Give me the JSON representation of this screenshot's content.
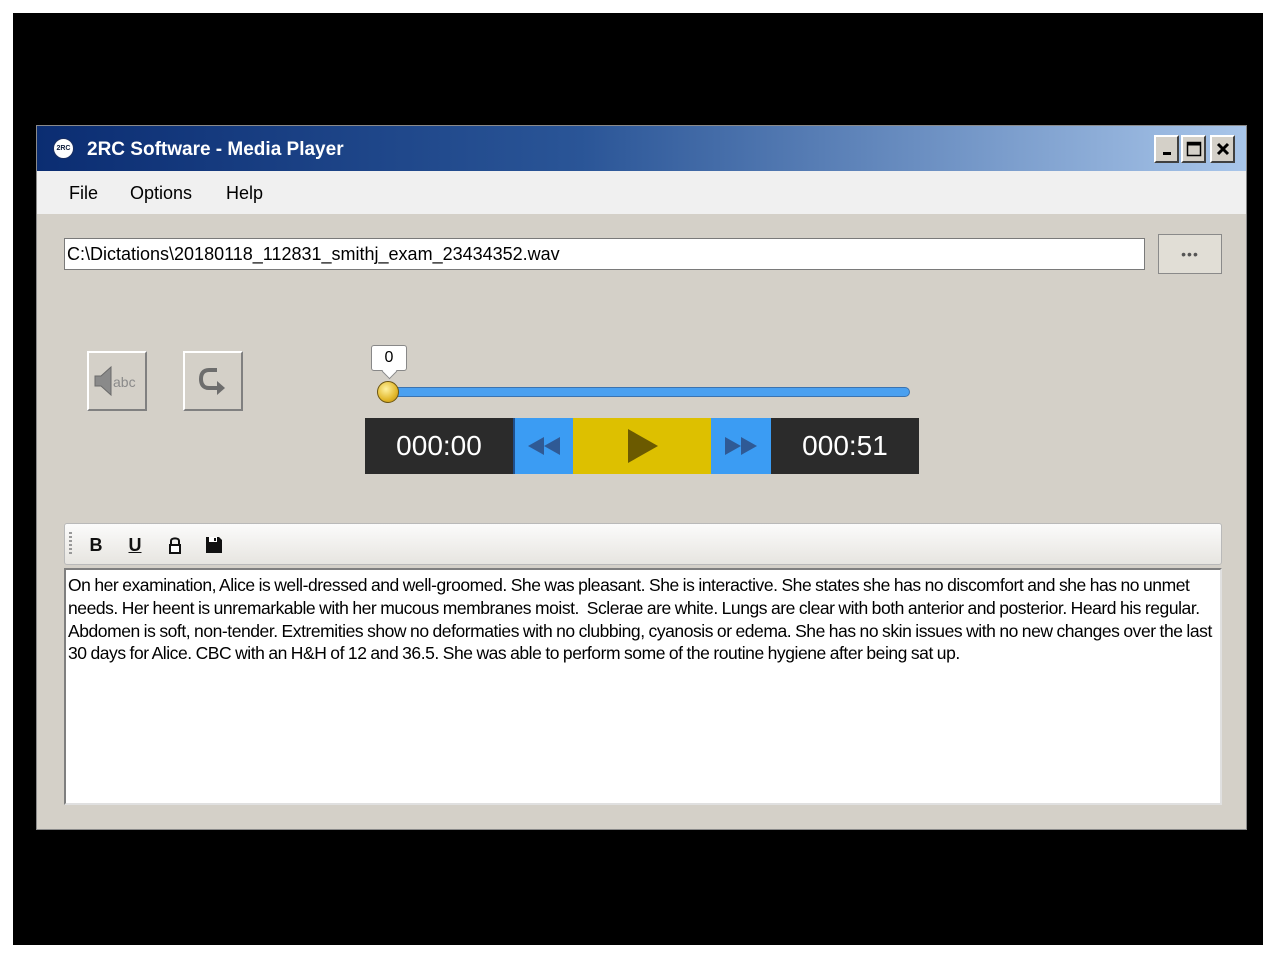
{
  "window": {
    "title": "2RC Software - Media Player",
    "logo_text": "2RC",
    "icons": {
      "logo": "app-logo-icon",
      "minimize": "minimize-icon",
      "maximize": "maximize-icon",
      "close": "close-icon"
    }
  },
  "menu": {
    "items": [
      {
        "label": "File"
      },
      {
        "label": "Options"
      },
      {
        "label": "Help"
      }
    ]
  },
  "file": {
    "path": "C:\\Dictations\\20180118_112831_smithj_exam_23434352.wav",
    "browse_label": "•••"
  },
  "tools": {
    "speak_icon": "speaker-abc-icon",
    "redo_icon": "redo-arrow-icon"
  },
  "player": {
    "position_value": "0",
    "progress_fraction": 0,
    "current_time": "000:00",
    "total_time": "000:51",
    "icons": {
      "rewind": "rewind-icon",
      "play": "play-icon",
      "forward": "fast-forward-icon"
    },
    "colors": {
      "time_bg": "#2b2b2b",
      "skip_bg": "#3b9cf3",
      "play_bg": "#ddc000"
    }
  },
  "editor": {
    "toolbar": {
      "bold_label": "B",
      "underline_label": "U",
      "icons": {
        "lock": "lock-icon",
        "save": "save-icon"
      }
    },
    "text": "On her examination, Alice is well-dressed and well-groomed. She was pleasant. She is interactive. She states she has no discomfort and she has no unmet needs. Her heent is unremarkable with her mucous membranes moist.  Sclerae are white. Lungs are clear with both anterior and posterior. Heard his regular. Abdomen is soft, non-tender. Extremities show no deformaties with no clubbing, cyanosis or edema. She has no skin issues with no new changes over the last 30 days for Alice. CBC with an H&H of 12 and 36.5. She was able to perform some of the routine hygiene after being sat up."
  }
}
